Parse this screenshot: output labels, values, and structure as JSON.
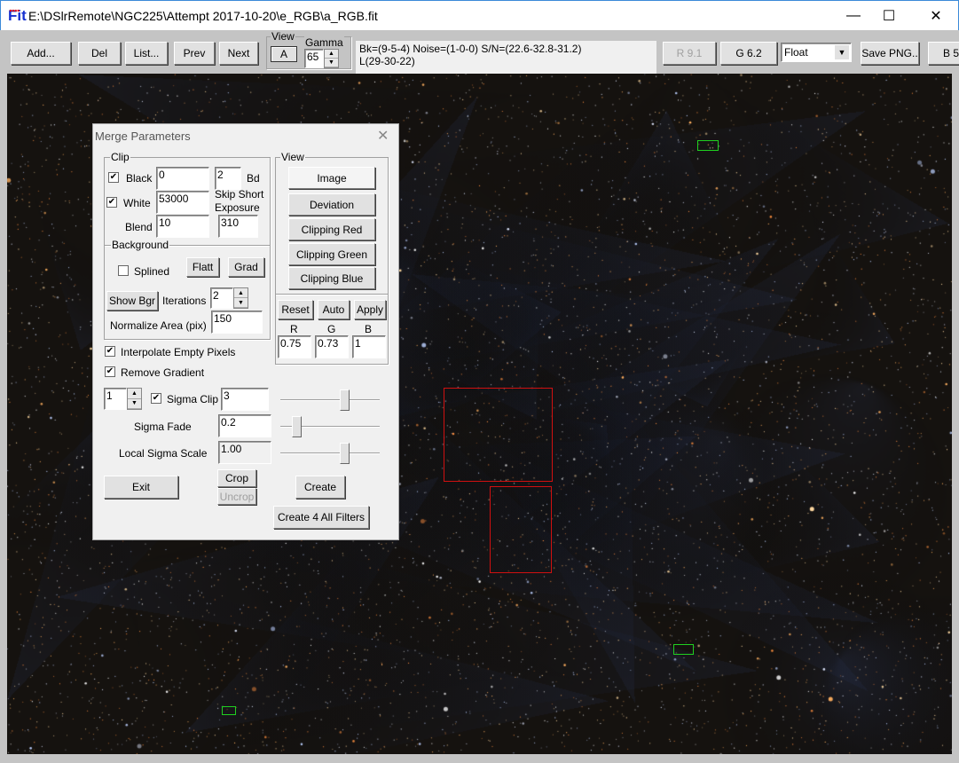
{
  "window": {
    "title": "E:\\DSlrRemote\\NGC225\\Attempt 2017-10-20\\e_RGB\\a_RGB.fit",
    "app_icon_label": "Fit",
    "minimize": "—",
    "maximize": "☐",
    "close": "✕"
  },
  "toolbar": {
    "add": "Add...",
    "del": "Del",
    "list": "List...",
    "prev": "Prev",
    "next": "Next",
    "view_label": "View",
    "view_button": "A",
    "gamma_label": "Gamma",
    "gamma_value": "65",
    "info_line1": "Bk=(9-5-4) Noise=(1-0-0) S/N=(22.6-32.8-31.2)",
    "info_line2": "L(29-30-22)",
    "r_button": "R 9.1",
    "g_button": "G 6.2",
    "format_select": "Float",
    "save_png": "Save PNG..",
    "b_button": "B 5"
  },
  "dialog": {
    "title": "Merge Parameters",
    "close": "✕",
    "clip": {
      "label": "Clip",
      "black_label": "Black",
      "black_checked": true,
      "black_value": "0",
      "bd_value": "2",
      "bd_label": "Bd",
      "white_label": "White",
      "white_checked": true,
      "white_value": "53000",
      "skip_label_1": "Skip Short",
      "skip_label_2": "Exposure",
      "blend_label": "Blend",
      "blend_value": "10",
      "skip_value": "310"
    },
    "background": {
      "label": "Background",
      "splined_label": "Splined",
      "splined_checked": false,
      "flatt": "Flatt",
      "grad": "Grad",
      "show_bgr": "Show Bgr",
      "iterations_label": "Iterations",
      "iterations_value": "2",
      "normalize_label": "Normalize Area (pix)",
      "normalize_value": "150"
    },
    "view": {
      "label": "View",
      "buttons": [
        "Image",
        "Deviation",
        "Clipping Red",
        "Clipping Green",
        "Clipping Blue"
      ],
      "reset": "Reset",
      "auto": "Auto",
      "apply": "Apply",
      "r_label": "R",
      "g_label": "G",
      "b_label": "B",
      "r_value": "0.75",
      "g_value": "0.73",
      "b_value": "1"
    },
    "interpolate_label": "Interpolate Empty Pixels",
    "interpolate_checked": true,
    "remove_gradient_label": "Remove Gradient",
    "remove_gradient_checked": true,
    "sigma_spin_value": "1",
    "sigma_clip_label": "Sigma Clip",
    "sigma_clip_checked": true,
    "sigma_clip_value": "3",
    "sigma_clip_slider": 0.6,
    "sigma_fade_label": "Sigma Fade",
    "sigma_fade_value": "0.2",
    "sigma_fade_slider": 0.12,
    "local_sigma_label": "Local Sigma Scale",
    "local_sigma_value": "1.00",
    "local_sigma_slider": 0.6,
    "exit": "Exit",
    "crop": "Crop",
    "uncrop": "Uncrop",
    "create": "Create",
    "create_all": "Create 4 All Filters"
  },
  "colors": {
    "selection_green": "#20d020",
    "selection_red": "#d01010",
    "sky": "#15120f"
  }
}
